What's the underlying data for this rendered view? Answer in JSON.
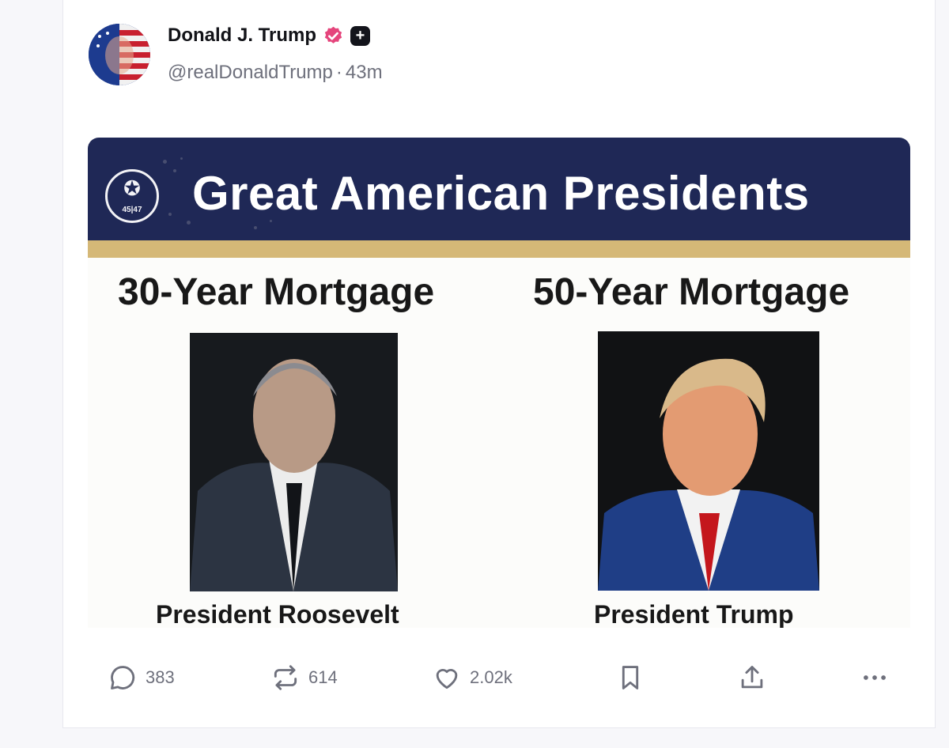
{
  "post": {
    "author": {
      "display_name": "Donald J. Trump",
      "handle": "@realDonaldTrump",
      "time_ago": "43m",
      "separator": "·",
      "plus_badge": "+",
      "verified_icon": "verified-badge-icon"
    },
    "media": {
      "banner_title": "Great American Presidents",
      "seal_text": "45|47",
      "left": {
        "heading": "30-Year Mortgage",
        "caption": "President Roosevelt"
      },
      "right": {
        "heading": "50-Year Mortgage",
        "caption": "President Trump"
      }
    },
    "actions": {
      "replies": "383",
      "reposts": "614",
      "likes": "2.02k"
    }
  },
  "colors": {
    "banner_navy": "#1f2856",
    "gold_rule": "#d5b877",
    "verified_pink": "#e5457c",
    "muted_text": "#6e707c"
  }
}
